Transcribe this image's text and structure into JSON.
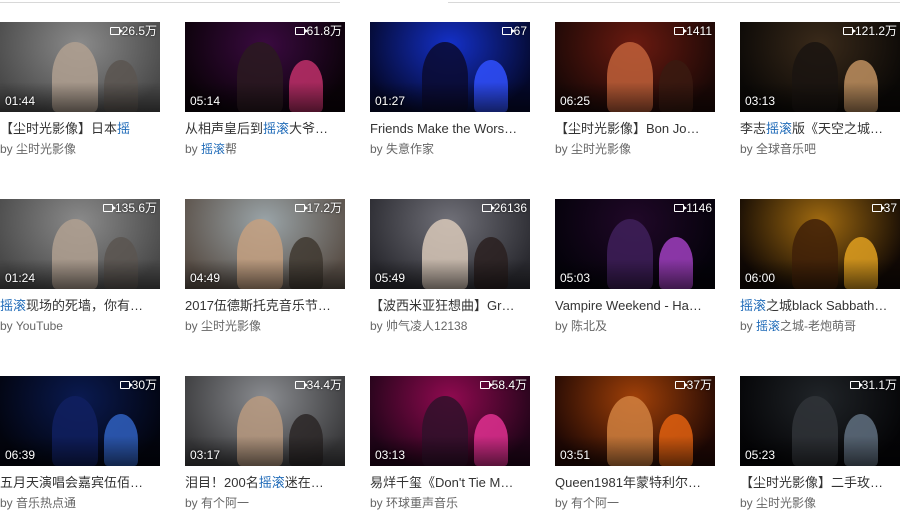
{
  "accent_color": "#1e6ab8",
  "videos": [
    {
      "plays": "26.5万",
      "duration": "01:44",
      "title_pre": "【尘时光影像】日本",
      "title_hl": "摇",
      "title_post": "",
      "by": "by",
      "author_pre": "尘时光影像",
      "author_hl": "",
      "author_post": "",
      "theme": "crowd-gray"
    },
    {
      "plays": "61.8万",
      "duration": "05:14",
      "title_pre": "从相声皇后到",
      "title_hl": "摇滚",
      "title_post": "大爷…",
      "by": "by",
      "author_pre": "",
      "author_hl": "摇滚",
      "author_post": "帮",
      "theme": "purple-stage"
    },
    {
      "plays": "67",
      "duration": "01:27",
      "title_pre": "Friends Make the Wors…",
      "title_hl": "",
      "title_post": "",
      "by": "by",
      "author_pre": "失意作家",
      "author_hl": "",
      "author_post": "",
      "theme": "blue-stage"
    },
    {
      "plays": "1411",
      "duration": "06:25",
      "title_pre": "【尘时光影像】Bon Jo…",
      "title_hl": "",
      "title_post": "",
      "by": "by",
      "author_pre": "尘时光影像",
      "author_hl": "",
      "author_post": "",
      "theme": "red-singer"
    },
    {
      "plays": "121.2万",
      "duration": "03:13",
      "title_pre": "李志",
      "title_hl": "摇滚",
      "title_post": "版《天空之城…",
      "by": "by",
      "author_pre": "全球音乐吧",
      "author_hl": "",
      "author_post": "",
      "theme": "dark-warm"
    },
    {
      "plays": "135.6万",
      "duration": "01:24",
      "title_pre": "",
      "title_hl": "摇滚",
      "title_post": "现场的死墙，你有…",
      "by": "by",
      "author_pre": "YouTube",
      "author_hl": "",
      "author_post": "",
      "theme": "crowd-gray"
    },
    {
      "plays": "17.2万",
      "duration": "04:49",
      "title_pre": "2017伍德斯托克音乐节…",
      "title_hl": "",
      "title_post": "",
      "by": "by",
      "author_pre": "尘时光影像",
      "author_hl": "",
      "author_post": "",
      "theme": "daylight-crowd"
    },
    {
      "plays": "26136",
      "duration": "05:49",
      "title_pre": "【波西米亚狂想曲】Gr…",
      "title_hl": "",
      "title_post": "",
      "by": "by",
      "author_pre": "帅气凌人12138",
      "author_hl": "",
      "author_post": "",
      "theme": "gray-stage"
    },
    {
      "plays": "1146",
      "duration": "05:03",
      "title_pre": "Vampire Weekend - Ha…",
      "title_hl": "",
      "title_post": "",
      "by": "by",
      "author_pre": "陈北及",
      "author_hl": "",
      "author_post": "",
      "theme": "night-band"
    },
    {
      "plays": "37",
      "duration": "06:00",
      "title_pre": "",
      "title_hl": "摇滚",
      "title_post": "之城black Sabbath…",
      "by": "by",
      "author_pre": "",
      "author_hl": "摇滚",
      "author_post": "之城-老炮萌哥",
      "theme": "amber-stage"
    },
    {
      "plays": "30万",
      "duration": "06:39",
      "title_pre": "五月天演唱会嘉宾伍佰…",
      "title_hl": "",
      "title_post": "",
      "by": "by",
      "author_pre": "音乐热点通",
      "author_hl": "",
      "author_post": "",
      "theme": "navy-stage"
    },
    {
      "plays": "34.4万",
      "duration": "03:17",
      "title_pre": "泪目！200名",
      "title_hl": "摇滚",
      "title_post": "迷在…",
      "by": "by",
      "author_pre": "有个阿一",
      "author_hl": "",
      "author_post": "",
      "theme": "outdoor-gray"
    },
    {
      "plays": "58.4万",
      "duration": "03:13",
      "title_pre": "易烊千玺《Don't Tie M…",
      "title_hl": "",
      "title_post": "",
      "by": "by",
      "author_pre": "环球重声音乐",
      "author_hl": "",
      "author_post": "",
      "theme": "magenta-stage"
    },
    {
      "plays": "37万",
      "duration": "03:51",
      "title_pre": "Queen1981年蒙特利尔…",
      "title_hl": "",
      "title_post": "",
      "by": "by",
      "author_pre": "有个阿一",
      "author_hl": "",
      "author_post": "",
      "theme": "orange-stage"
    },
    {
      "plays": "31.1万",
      "duration": "05:23",
      "title_pre": "【尘时光影像】二手玫…",
      "title_hl": "",
      "title_post": "",
      "by": "by",
      "author_pre": "尘时光影像",
      "author_hl": "",
      "author_post": "",
      "theme": "black-singer"
    }
  ]
}
